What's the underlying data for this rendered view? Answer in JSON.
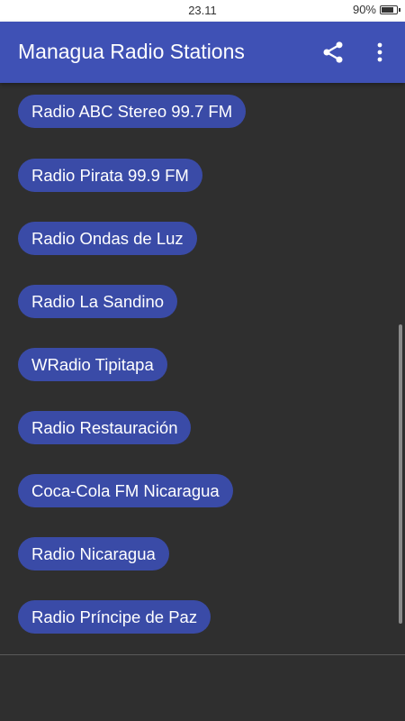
{
  "status_bar": {
    "time": "23.11",
    "battery": "90%",
    "battery_level": 0.9
  },
  "app_bar": {
    "title": "Managua Radio Stations",
    "share_icon": "share-icon",
    "overflow_icon": "more-vert-icon"
  },
  "stations": [
    "Radio ABC Stereo 99.7 FM",
    "Radio Pirata 99.9 FM",
    "Radio Ondas de Luz",
    "Radio La Sandino",
    "WRadio Tipitapa",
    "Radio Restauración",
    "Coca-Cola FM Nicaragua",
    "Radio Nicaragua",
    "Radio Príncipe de Paz"
  ],
  "colors": {
    "app_bar": "#3f51b5",
    "station_button": "#3a4ba7",
    "background": "#2f2f2f"
  }
}
